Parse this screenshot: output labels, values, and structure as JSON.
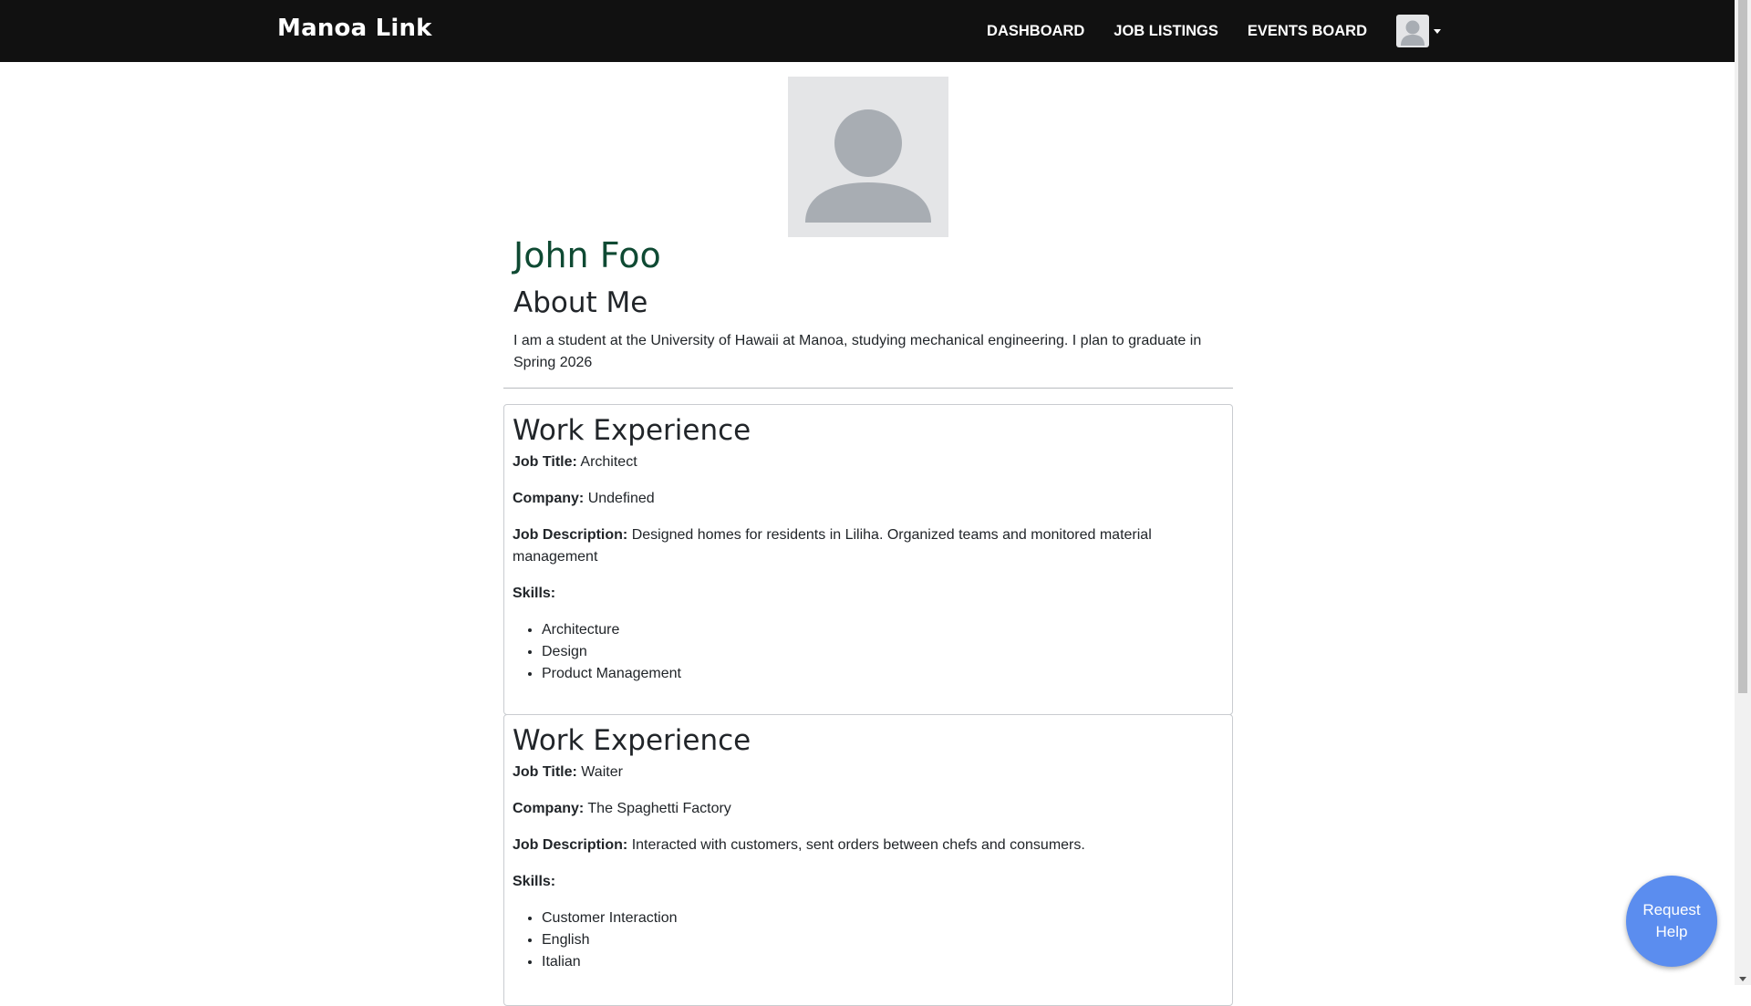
{
  "navbar": {
    "brand": "Manoa Link",
    "links": [
      "DASHBOARD",
      "JOB LISTINGS",
      "EVENTS BOARD"
    ],
    "avatar_icon": "user-placeholder-icon"
  },
  "profile": {
    "photo_icon": "user-placeholder-icon",
    "name": "John Foo",
    "about_heading": "About Me",
    "about_text": "I am a student at the University of Hawaii at Manoa, studying mechanical engineering. I plan to graduate in Spring 2026"
  },
  "experiences": [
    {
      "heading": "Work Experience",
      "job_title_label": "Job Title:",
      "job_title": "Architect",
      "company_label": "Company:",
      "company": "Undefined",
      "description_label": "Job Description:",
      "description": "Designed homes for residents in Liliha. Organized teams and monitored material management",
      "skills_label": "Skills:",
      "skills": [
        "Architecture",
        "Design",
        "Product Management"
      ]
    },
    {
      "heading": "Work Experience",
      "job_title_label": "Job Title:",
      "job_title": "Waiter",
      "company_label": "Company:",
      "company": "The Spaghetti Factory",
      "description_label": "Job Description:",
      "description": "Interacted with customers, sent orders between chefs and consumers.",
      "skills_label": "Skills:",
      "skills": [
        "Customer Interaction",
        "English",
        "Italian"
      ]
    }
  ],
  "help_button": {
    "label": "Request Help"
  },
  "colors": {
    "navbar_bg": "#111111",
    "name_green": "#0f4a33",
    "help_blue": "#5b8def",
    "placeholder_bg": "#e4e5e7",
    "placeholder_fg": "#a8adb3"
  }
}
